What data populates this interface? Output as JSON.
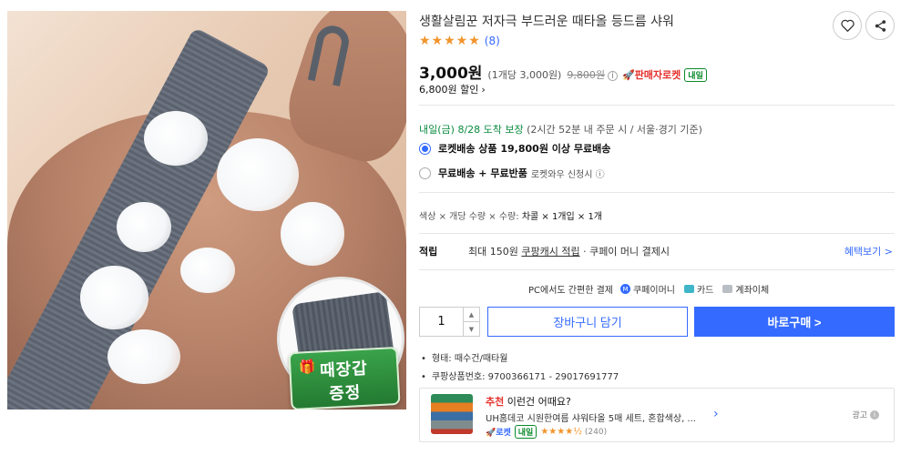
{
  "product": {
    "title": "생활살림꾼 저자극 부드러운 때타올 등드름 샤워",
    "rating_stars": "★★★★★",
    "review_count": "(8)",
    "image_badge": {
      "line1": "때장갑",
      "line2": "증정"
    }
  },
  "price": {
    "current": "3,000원",
    "unit": "(1개당 3,000원)",
    "original": "9,800원",
    "seller_rocket": "판매자로켓",
    "tomorrow_badge": "내일",
    "discount": "6,800원 할인"
  },
  "delivery": {
    "date": "내일(금) 8/28 도착 보장",
    "note": "(2시간 52분 내 주문 시 / 서울·경기 기준)",
    "options": [
      {
        "label": "로켓배송 상품 19,800원 이상 무료배송",
        "extra": "",
        "selected": true
      },
      {
        "label": "무료배송 + 무료반품",
        "extra": "로켓와우 신청시 ⓘ",
        "selected": false
      }
    ]
  },
  "option_path": {
    "prefix": "색상 × 개당 수량 × 수량:",
    "selected": "차콜 × 1개입 × 1개"
  },
  "points": {
    "label": "적립",
    "text_prefix": "최대 150원",
    "link": "쿠팡캐시 적립",
    "text_suffix": "· 쿠페이 머니 결제시",
    "benefit": "혜택보기 >"
  },
  "payment": {
    "label": "PC에서도 간편한 결제",
    "methods": [
      "쿠페이머니",
      "카드",
      "계좌이체"
    ]
  },
  "purchase": {
    "quantity": "1",
    "cart_label": "장바구니 담기",
    "buy_label": "바로구매 >"
  },
  "specs": [
    "형태: 때수건/때타월",
    "쿠팡상품번호: 9700366171 - 29017691777"
  ],
  "recommendation": {
    "head_highlight": "추천",
    "head_text": "이런건 어때요?",
    "name": "UH홈데코 시원한여름 샤워타올 5매 세트, 혼합색상, ...",
    "rocket": "로켓",
    "tomorrow": "내일",
    "stars": "★★★★½",
    "count": "(240)",
    "ad_label": "광고"
  },
  "colors": {
    "accent": "#346aff",
    "star": "#f2932c",
    "delivery_green": "#0a8a3f",
    "rocket_red": "#e4302b"
  },
  "icons": {
    "wishlist": "heart-icon",
    "share": "share-icon",
    "info": "info-icon"
  }
}
